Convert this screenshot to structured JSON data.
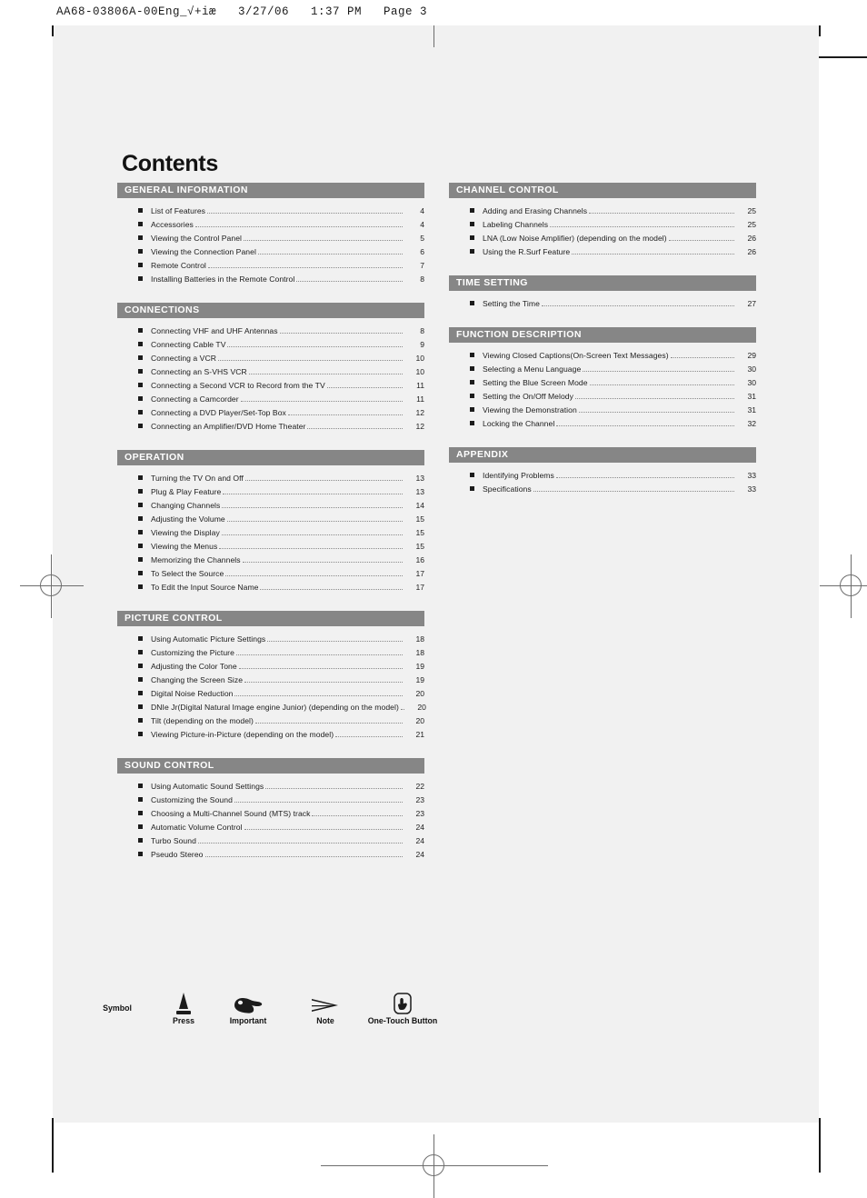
{
  "print_header": "AA68-03806A-00Eng_√+iæ   3/27/06   1:37 PM   Page 3",
  "page_title": "Contents",
  "colors": {
    "section_header_bg": "#868686",
    "page_bg": "#f1f1f1",
    "text": "#1c1c1c"
  },
  "left_column": [
    {
      "heading": "GENERAL INFORMATION",
      "entries": [
        {
          "label": "List of Features",
          "page": "4"
        },
        {
          "label": "Accessories",
          "page": "4"
        },
        {
          "label": "Viewing the Control Panel",
          "page": "5"
        },
        {
          "label": "Viewing the Connection Panel",
          "page": "6"
        },
        {
          "label": "Remote Control",
          "page": "7"
        },
        {
          "label": "Installing Batteries in the Remote Control",
          "page": "8"
        }
      ]
    },
    {
      "heading": "CONNECTIONS",
      "entries": [
        {
          "label": "Connecting VHF and UHF Antennas",
          "page": "8"
        },
        {
          "label": "Connecting Cable TV",
          "page": "9"
        },
        {
          "label": "Connecting a VCR",
          "page": "10"
        },
        {
          "label": "Connecting an S-VHS VCR",
          "page": "10"
        },
        {
          "label": "Connecting a Second VCR to Record from the TV",
          "page": "11"
        },
        {
          "label": "Connecting a Camcorder",
          "page": "11"
        },
        {
          "label": "Connecting a DVD Player/Set-Top Box",
          "page": "12"
        },
        {
          "label": "Connecting an Amplifier/DVD Home Theater",
          "page": "12"
        }
      ]
    },
    {
      "heading": "OPERATION",
      "entries": [
        {
          "label": "Turning the TV On and Off",
          "page": "13"
        },
        {
          "label": "Plug & Play Feature",
          "page": "13"
        },
        {
          "label": "Changing Channels",
          "page": "14"
        },
        {
          "label": "Adjusting the Volume",
          "page": "15"
        },
        {
          "label": "Viewing the Display",
          "page": "15"
        },
        {
          "label": "Viewing the Menus",
          "page": "15"
        },
        {
          "label": "Memorizing the Channels",
          "page": "16"
        },
        {
          "label": "To Select the Source",
          "page": "17"
        },
        {
          "label": "To Edit the Input Source Name",
          "page": "17"
        }
      ]
    },
    {
      "heading": "PICTURE CONTROL",
      "entries": [
        {
          "label": "Using Automatic Picture Settings",
          "page": "18"
        },
        {
          "label": "Customizing the Picture",
          "page": "18"
        },
        {
          "label": "Adjusting the Color Tone",
          "page": "19"
        },
        {
          "label": "Changing the Screen Size",
          "page": "19"
        },
        {
          "label": "Digital Noise Reduction",
          "page": "20"
        },
        {
          "label": "DNIe Jr(Digital Natural Image engine Junior) (depending on the model)",
          "page": "20"
        },
        {
          "label": "Tilt (depending on the model)",
          "page": "20"
        },
        {
          "label": "Viewing Picture-in-Picture (depending on the model)",
          "page": "21"
        }
      ]
    },
    {
      "heading": "SOUND CONTROL",
      "entries": [
        {
          "label": "Using Automatic Sound Settings",
          "page": "22"
        },
        {
          "label": "Customizing the Sound",
          "page": "23"
        },
        {
          "label": "Choosing a Multi-Channel Sound (MTS) track",
          "page": "23"
        },
        {
          "label": "Automatic Volume Control",
          "page": "24"
        },
        {
          "label": "Turbo Sound",
          "page": "24"
        },
        {
          "label": "Pseudo Stereo",
          "page": "24"
        }
      ]
    }
  ],
  "right_column": [
    {
      "heading": "CHANNEL CONTROL",
      "entries": [
        {
          "label": "Adding and Erasing Channels",
          "page": "25"
        },
        {
          "label": "Labeling Channels",
          "page": "25"
        },
        {
          "label": "LNA (Low Noise Amplifier) (depending on the model)",
          "page": "26"
        },
        {
          "label": "Using the R.Surf Feature",
          "page": "26"
        }
      ]
    },
    {
      "heading": "TIME SETTING",
      "entries": [
        {
          "label": "Setting the Time",
          "page": "27"
        }
      ]
    },
    {
      "heading": "FUNCTION DESCRIPTION",
      "entries": [
        {
          "label": "Viewing Closed Captions(On-Screen Text Messages)",
          "page": "29"
        },
        {
          "label": "Selecting a Menu Language",
          "page": "30"
        },
        {
          "label": "Setting the Blue Screen Mode",
          "page": "30"
        },
        {
          "label": "Setting the On/Off Melody",
          "page": "31"
        },
        {
          "label": "Viewing the Demonstration",
          "page": "31"
        },
        {
          "label": "Locking the Channel",
          "page": "32"
        }
      ]
    },
    {
      "heading": "APPENDIX",
      "entries": [
        {
          "label": "Identifying Problems",
          "page": "33"
        },
        {
          "label": "Specifications",
          "page": "33"
        }
      ]
    }
  ],
  "legend": [
    {
      "caption": "Symbol",
      "icon": "none"
    },
    {
      "caption": "Press",
      "icon": "press-triangle-icon"
    },
    {
      "caption": "Important",
      "icon": "pointing-hand-icon"
    },
    {
      "caption": "Note",
      "icon": "arrow-note-icon"
    },
    {
      "caption": "One-Touch Button",
      "icon": "one-touch-button-icon"
    }
  ]
}
